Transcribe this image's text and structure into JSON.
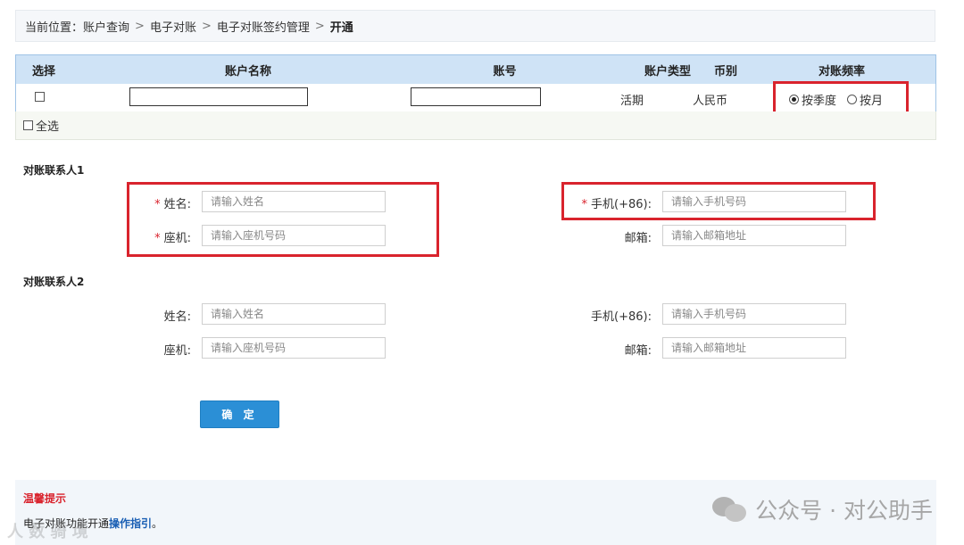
{
  "breadcrumb": {
    "prefix": "当前位置：",
    "items": [
      "账户查询",
      "电子对账",
      "电子对账签约管理"
    ],
    "current": "开通"
  },
  "table": {
    "headers": [
      "选择",
      "账户名称",
      "账号",
      "账户类型",
      "币别",
      "对账频率"
    ],
    "row": {
      "account_name": "",
      "account_no": "",
      "account_type": "活期",
      "currency": "人民币",
      "freq_options": [
        "按季度",
        "按月"
      ],
      "freq_selected": "按季度"
    },
    "select_all_label": "全选"
  },
  "contact1": {
    "title": "对账联系人1",
    "name_label": "姓名:",
    "name_placeholder": "请输入姓名",
    "landline_label": "座机:",
    "landline_placeholder": "请输入座机号码",
    "mobile_label": "手机(+86):",
    "mobile_placeholder": "请输入手机号码",
    "email_label": "邮箱:",
    "email_placeholder": "请输入邮箱地址",
    "required_mark": "*"
  },
  "contact2": {
    "title": "对账联系人2",
    "name_label": "姓名:",
    "name_placeholder": "请输入姓名",
    "landline_label": "座机:",
    "landline_placeholder": "请输入座机号码",
    "mobile_label": "手机(+86):",
    "mobile_placeholder": "请输入手机号码",
    "email_label": "邮箱:",
    "email_placeholder": "请输入邮箱地址"
  },
  "confirm_label": "确 定",
  "tips": {
    "title": "温馨提示",
    "text": "电子对账功能开通",
    "link": "操作指引",
    "suffix": "。"
  },
  "watermark": {
    "text": "公众号 · 对公助手",
    "text2": "人 数 骑 境"
  },
  "colors": {
    "accent": "#2b8fd6",
    "header_bg": "#cfe3f6",
    "highlight_red": "#d9232d",
    "link": "#1a5fb4"
  }
}
